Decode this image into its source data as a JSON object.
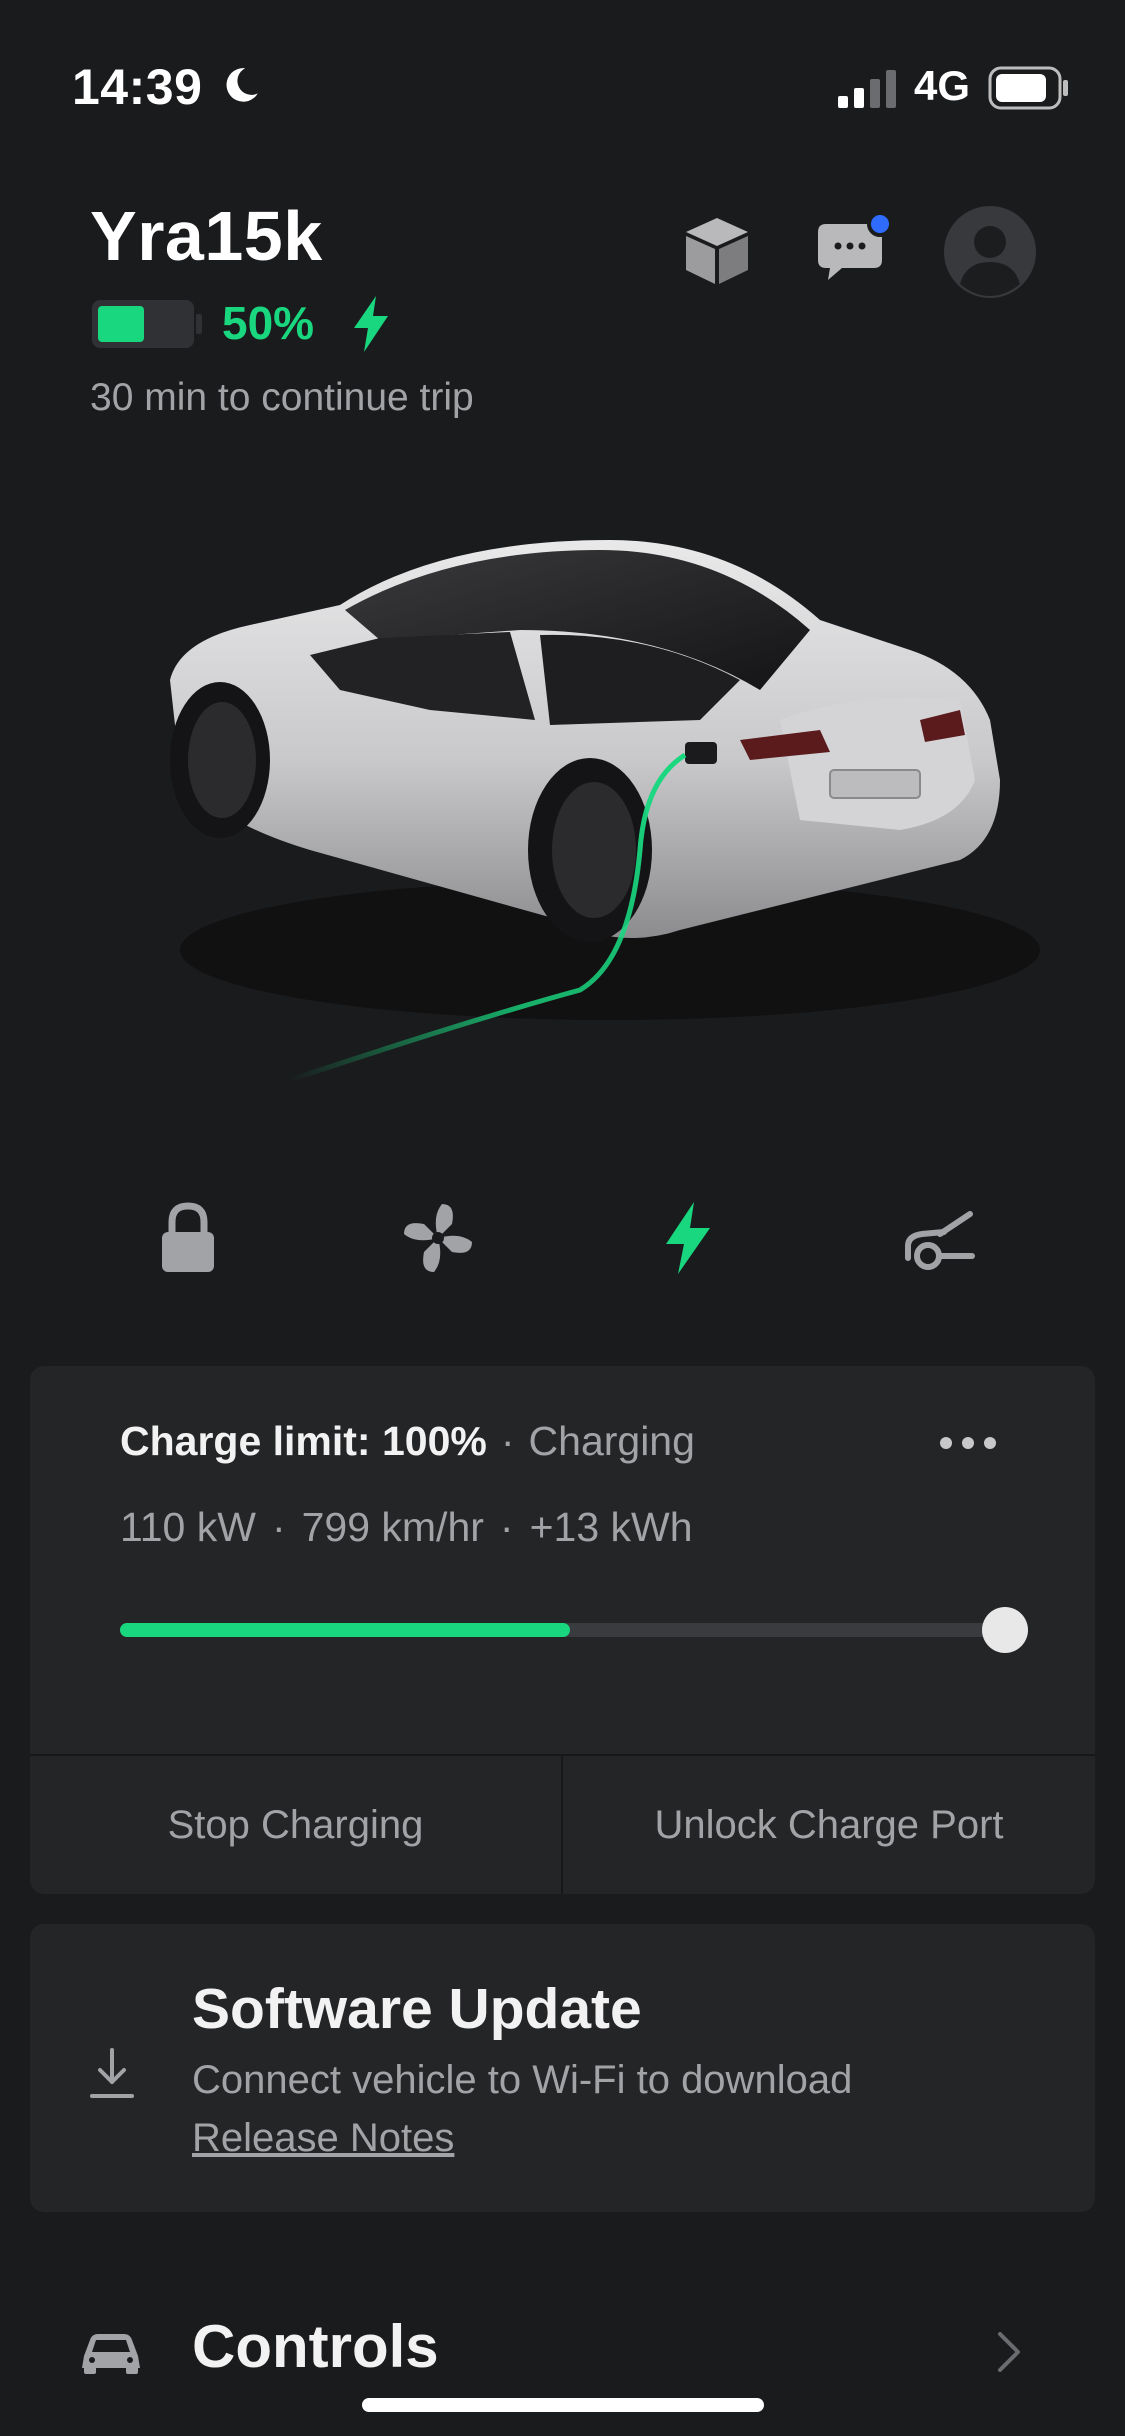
{
  "status_bar": {
    "time": "14:39",
    "network": "4G",
    "icons": [
      "moon-icon",
      "signal-icon",
      "battery-icon"
    ]
  },
  "vehicle": {
    "name": "Yra15k",
    "battery_percent_label": "50%",
    "battery_level": 0.5,
    "trip_text": "30 min to continue trip"
  },
  "header_icons": [
    "cube-icon",
    "chat-icon",
    "avatar-icon"
  ],
  "quick_actions": [
    "lock-icon",
    "fan-icon",
    "charge-bolt-icon",
    "frunk-icon"
  ],
  "charging": {
    "limit_label": "Charge limit:",
    "limit_value": "100%",
    "status": "Charging",
    "stats": [
      "110 kW",
      "799 km/hr",
      "+13 kWh"
    ],
    "charge_level": 0.5,
    "limit_level": 1.0,
    "stop_label": "Stop Charging",
    "unlock_label": "Unlock Charge Port"
  },
  "software_update": {
    "title": "Software Update",
    "subtitle": "Connect vehicle to Wi-Fi to download",
    "link": "Release Notes"
  },
  "controls": {
    "label": "Controls"
  },
  "colors": {
    "accent_green": "#19d77f",
    "background": "#1a1b1d",
    "card": "#242527",
    "muted_text": "#a2a3a6",
    "notification_dot": "#2f6bff"
  }
}
